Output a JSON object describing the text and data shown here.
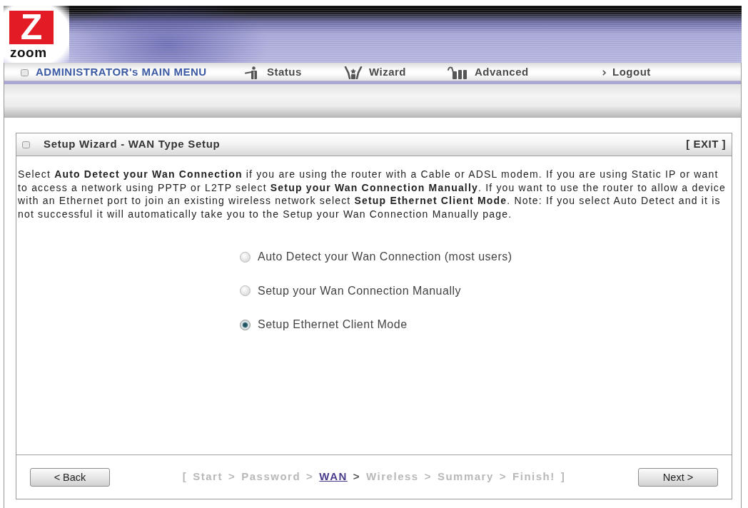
{
  "logo": {
    "mark": "Z",
    "wordmark": "zoom"
  },
  "nav": [
    {
      "kind": "heading",
      "label": "ADMINISTRATOR's MAIN MENU"
    },
    {
      "kind": "link",
      "label": "Status"
    },
    {
      "kind": "link",
      "label": "Wizard"
    },
    {
      "kind": "link",
      "label": "Advanced"
    },
    {
      "kind": "link",
      "label": "Logout"
    }
  ],
  "panel": {
    "title": "Setup Wizard - WAN Type Setup",
    "exit": "[ EXIT ]",
    "instructions": "Select **Auto Detect your Wan Connection** if you are using the router with a Cable or ADSL modem. If you are using Static IP or want to access a network using PPTP or L2TP select **Setup your Wan Connection Manually**. If you want to use the router to allow a device with an Ethernet port to join an existing wireless network select **Setup Ethernet Client Mode**. Note: If you select Auto Detect and it is not successful it will automatically take you to the Setup your Wan Connection Manually page.",
    "options": [
      {
        "label": "Auto Detect your Wan Connection (most users)",
        "selected": false
      },
      {
        "label": "Setup your Wan Connection Manually",
        "selected": false
      },
      {
        "label": "Setup Ethernet Client Mode",
        "selected": true
      }
    ]
  },
  "footer": {
    "back": "< Back",
    "next": "Next >",
    "steps_open": "[",
    "steps_close": "]",
    "steps": [
      {
        "label": "Start",
        "selected": false,
        "separator": ">"
      },
      {
        "label": "Password",
        "selected": false,
        "separator": ">"
      },
      {
        "label": "WAN",
        "selected": true,
        "separator": ">"
      },
      {
        "label": "Wireless",
        "selected": false,
        "separator": ">"
      },
      {
        "label": "Summary",
        "selected": false,
        "separator": ">"
      },
      {
        "label": "Finish!",
        "selected": false
      }
    ]
  }
}
